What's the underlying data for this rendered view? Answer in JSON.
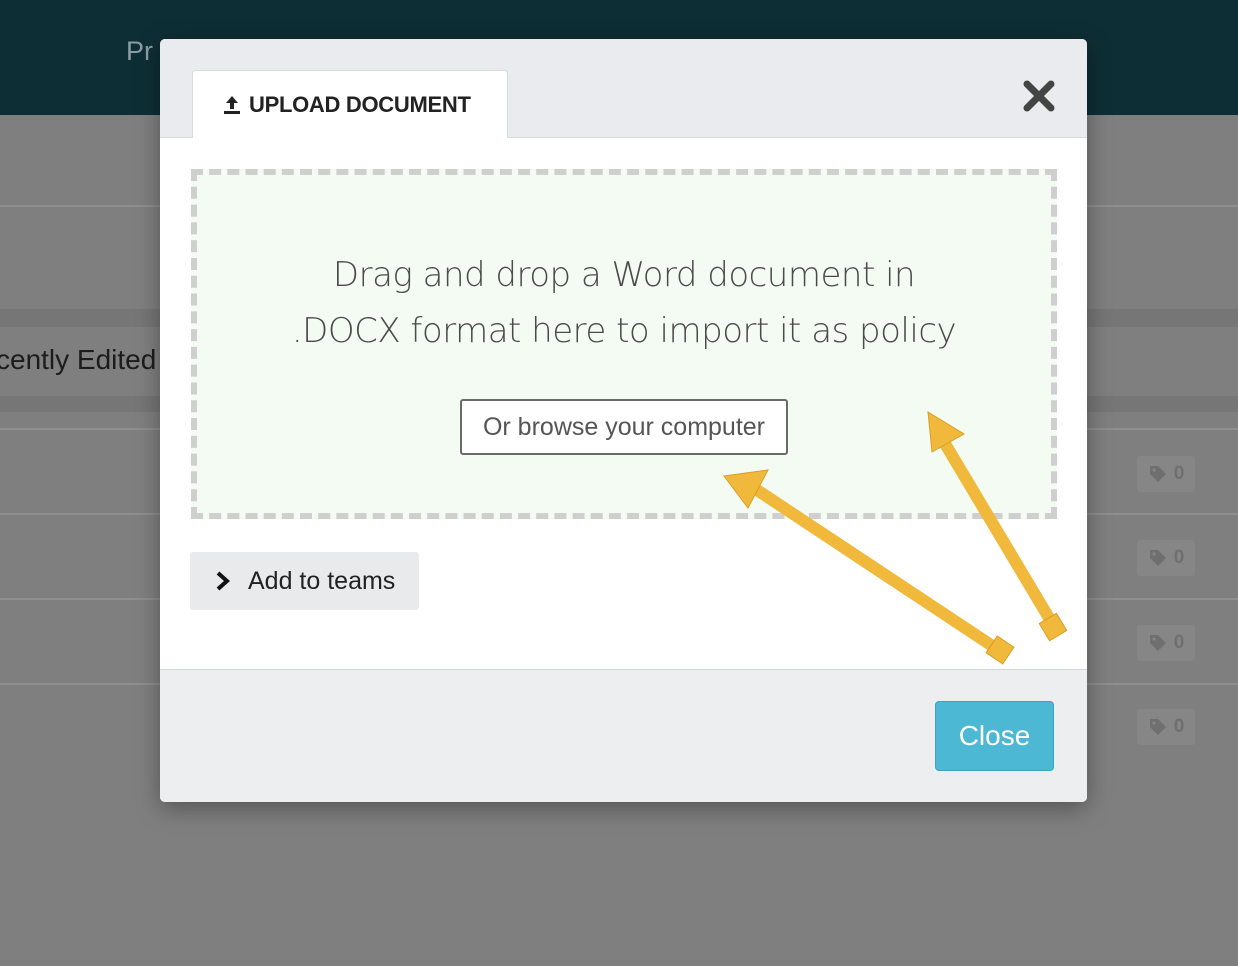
{
  "background": {
    "nav_text": "Pr",
    "recent_heading": "cently Edited",
    "tag_counts": [
      "0",
      "0",
      "0",
      "0"
    ],
    "tag_icon": "tag-icon"
  },
  "modal": {
    "tab_label": "UPLOAD DOCUMENT",
    "tab_icon": "upload-icon",
    "close_icon": "close-icon",
    "drop_text_line1": "Drag and drop a Word document in",
    "drop_text_line2": ".DOCX format here to import it as policy",
    "browse_label": "Or browse your computer",
    "teams_label": "Add to teams",
    "teams_icon": "chevron-right-icon",
    "close_label": "Close"
  },
  "colors": {
    "topbar": "#0e2e35",
    "dropzone_bg": "#f3fbf3",
    "close_button": "#4db8d3",
    "annotation_arrow": "#f0b93b"
  }
}
